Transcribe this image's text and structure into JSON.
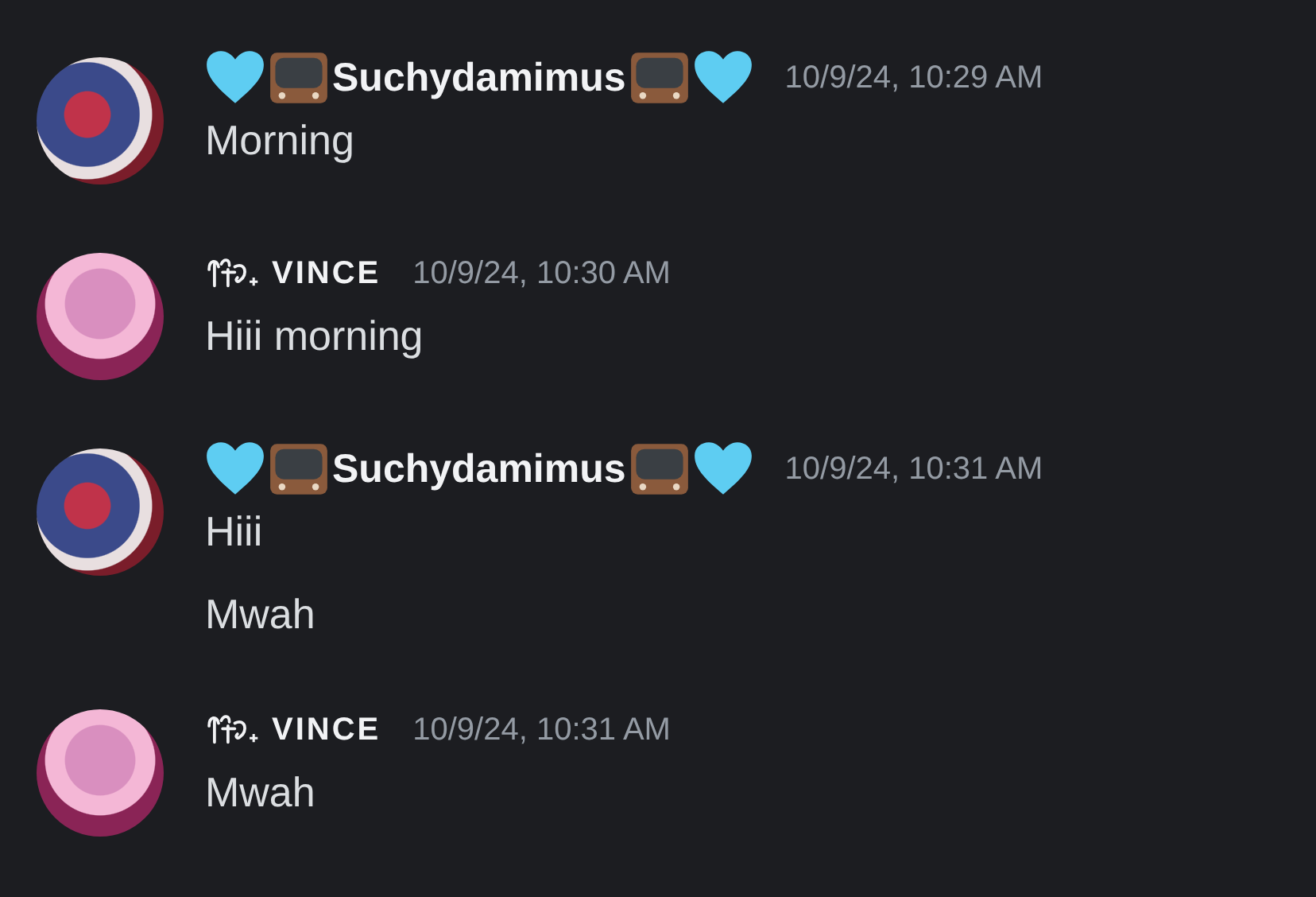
{
  "messages": [
    {
      "kind": "hearts",
      "author": "Suchydamimus",
      "timestamp": "10/9/24, 10:29 AM",
      "lines": [
        "Morning"
      ]
    },
    {
      "kind": "prefix",
      "author": "VINCE",
      "timestamp": "10/9/24, 10:30 AM",
      "lines": [
        "Hiii morning"
      ]
    },
    {
      "kind": "hearts",
      "author": "Suchydamimus",
      "timestamp": "10/9/24, 10:31 AM",
      "lines": [
        "Hiii",
        "Mwah"
      ]
    },
    {
      "kind": "prefix",
      "author": "VINCE",
      "timestamp": "10/9/24, 10:31 AM",
      "lines": [
        "Mwah"
      ]
    }
  ]
}
